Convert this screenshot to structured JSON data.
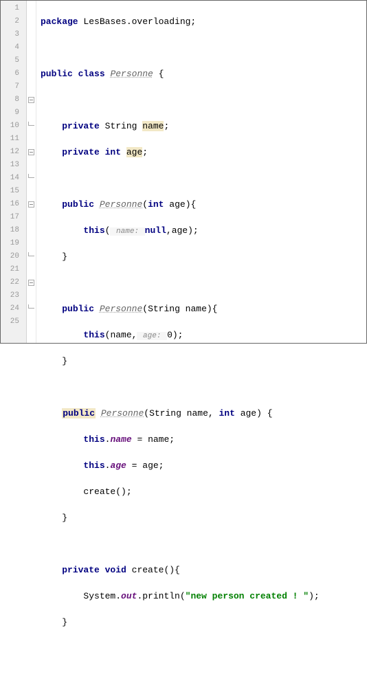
{
  "lines": {
    "l1": "1",
    "l2": "2",
    "l3": "3",
    "l4": "4",
    "l5": "5",
    "l6": "6",
    "l7": "7",
    "l8": "8",
    "l9": "9",
    "l10": "10",
    "l11": "11",
    "l12": "12",
    "l13": "13",
    "l14": "14",
    "l15": "15",
    "l16": "16",
    "l17": "17",
    "l18": "18",
    "l19": "19",
    "l20": "20",
    "l21": "21",
    "l22": "22",
    "l23": "23",
    "l24": "24",
    "l25": "25"
  },
  "tok": {
    "package": "package",
    "pkg_name": " LesBases.overloading;",
    "public": "public",
    "class": "class",
    "class_name": "Personne",
    "obrace": " {",
    "private": "private",
    "String": " String ",
    "int_sp": " int ",
    "name": "name",
    "semi": ";",
    "age": "age",
    "ctor1_sig_open": "(",
    "ctor1_sig_params": "int age)",
    "ctor1_sig_brace": "{",
    "this_kw": "this",
    "paren_open": "(",
    "hint_name": " name: ",
    "null_kw": "null",
    "comma_age": ",age);",
    "cbrace": "}",
    "ctor2_params": "(String name){",
    "ctor2_body_pre": "(name,",
    "hint_age": " age: ",
    "zero": "0",
    "paren_close_semi": ");",
    "ctor3_params": "(String name, ",
    "ctor3_int": "int",
    "ctor3_age": " age) {",
    "dot": ".",
    "eq_name": " = name;",
    "eq_age": " = age;",
    "create_call": "create();",
    "void": " void ",
    "create_name": "create",
    "create_params": "(){",
    "system": "System.",
    "out": "out",
    "println": ".println(",
    "msg": "\"new person created ! \"",
    "end_println": ");"
  }
}
